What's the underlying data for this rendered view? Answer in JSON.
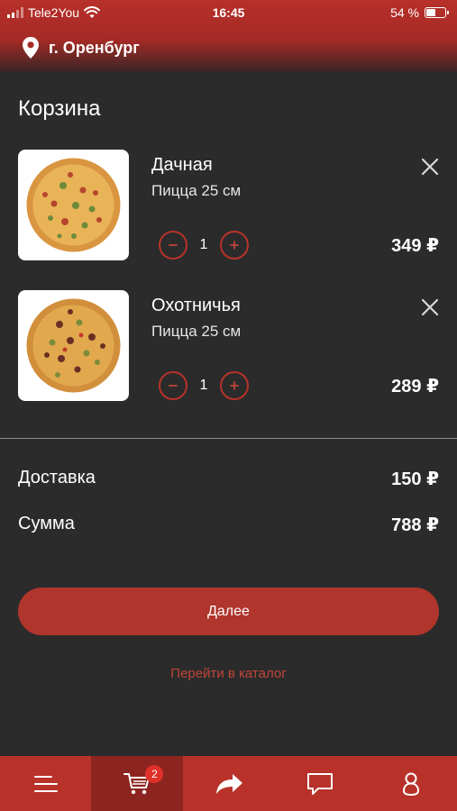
{
  "status_bar": {
    "carrier": "Tele2You",
    "time": "16:45",
    "battery_text": "54 %",
    "battery_level": 0.54
  },
  "header": {
    "city": "г. Оренбург",
    "location_icon": "location-pin-icon"
  },
  "cart": {
    "title": "Корзина",
    "items": [
      {
        "name": "Дачная",
        "description": "Пицца 25 см",
        "quantity": "1",
        "price": "349 ₽"
      },
      {
        "name": "Охотничья",
        "description": "Пицца 25 см",
        "quantity": "1",
        "price": "289 ₽"
      }
    ]
  },
  "summary": {
    "delivery_label": "Доставка",
    "delivery_value": "150 ₽",
    "total_label": "Сумма",
    "total_value": "788 ₽"
  },
  "actions": {
    "next_label": "Далее",
    "catalog_label": "Перейти в каталог"
  },
  "tabbar": {
    "tabs": [
      {
        "icon": "menu-icon"
      },
      {
        "icon": "cart-icon",
        "badge": "2",
        "active": true
      },
      {
        "icon": "share-arrow-icon"
      },
      {
        "icon": "chat-icon"
      },
      {
        "icon": "profile-icon"
      }
    ]
  },
  "colors": {
    "accent": "#b8322a",
    "background": "#2b2b2b",
    "link": "#c0453a"
  }
}
